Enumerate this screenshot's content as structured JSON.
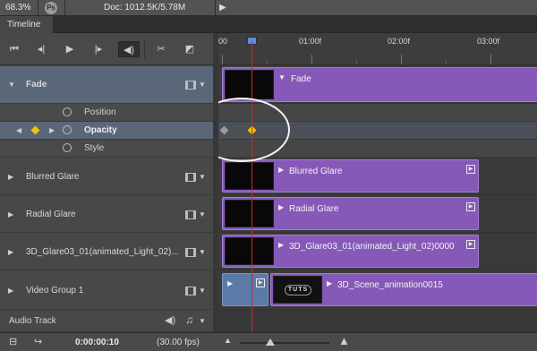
{
  "status": {
    "zoom": "68.3%",
    "doc": "Doc: 1012.5K/5.78M",
    "ps_icon": "Ps"
  },
  "panel": {
    "title": "Timeline"
  },
  "controls": [
    {
      "icon": "go-to-first-frame-icon",
      "glyph": "⏮"
    },
    {
      "icon": "previous-frame-icon",
      "glyph": "◂|"
    },
    {
      "icon": "play-icon",
      "glyph": "▶"
    },
    {
      "icon": "next-frame-icon",
      "glyph": "|▸"
    },
    {
      "icon": "mute-audio-icon",
      "glyph": "🔊"
    },
    {
      "icon": "split-at-playhead-icon",
      "glyph": "✂"
    },
    {
      "icon": "transition-icon",
      "glyph": "◩"
    }
  ],
  "ruler": {
    "labels": [
      "00",
      "01:00f",
      "02:00f",
      "03:00f"
    ]
  },
  "layers": {
    "fade": {
      "label": "Fade",
      "clip": "Fade"
    },
    "props": {
      "position": "Position",
      "opacity": "Opacity",
      "style": "Style"
    },
    "blurred": {
      "label": "Blurred Glare",
      "clip": "Blurred Glare"
    },
    "radial": {
      "label": "Radial Glare",
      "clip": "Radial Glare"
    },
    "glare3d": {
      "label": "3D_Glare03_01(animated_Light_02)...",
      "clip": "3D_Glare03_01(animated_Light_02)0000"
    },
    "video": {
      "label": "Video Group 1",
      "clip": "3D_Scene_animation0015",
      "thumb_text": "TUTS"
    },
    "audio": {
      "label": "Audio Track"
    }
  },
  "bottom": {
    "timecode": "0:00:00:10",
    "fps": "(30.00 fps)"
  },
  "colors": {
    "clip_purple": "#8659b8",
    "selected_row": "#5a6779",
    "playhead": "#dd2222",
    "keyframe_active": "#f2c100",
    "keyframe_inactive": "#9a9a9a"
  }
}
